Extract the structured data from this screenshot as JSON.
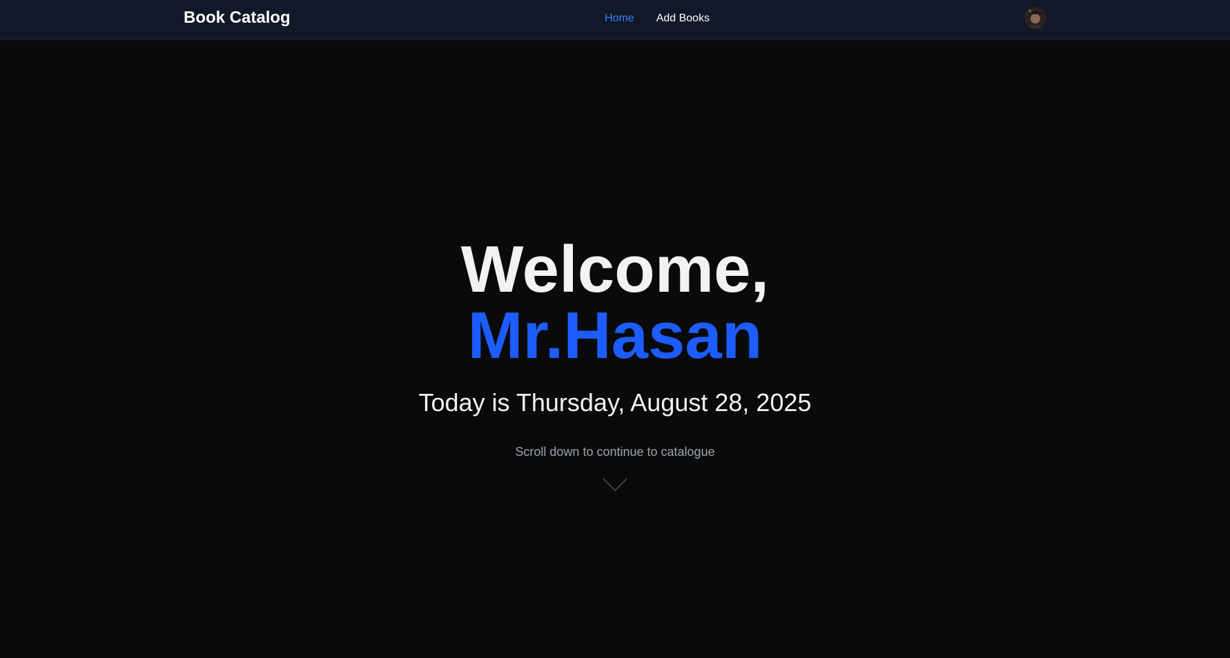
{
  "navbar": {
    "brand": "Book Catalog",
    "links": [
      {
        "label": "Home",
        "active": true
      },
      {
        "label": "Add Books",
        "active": false
      }
    ],
    "avatar_icon": "user-avatar"
  },
  "hero": {
    "greeting": "Welcome,",
    "name": "Mr.Hasan",
    "date_text": "Today is Thursday, August 28, 2025",
    "scroll_hint": "Scroll down to continue to catalogue",
    "scroll_icon": "chevron-down-icon"
  },
  "colors": {
    "background": "#0a0a0a",
    "navbar_bg": "#111827",
    "accent": "#1d5cff",
    "nav_active": "#3b82f6",
    "text": "#f2f2f2",
    "muted": "#9ca3af"
  }
}
